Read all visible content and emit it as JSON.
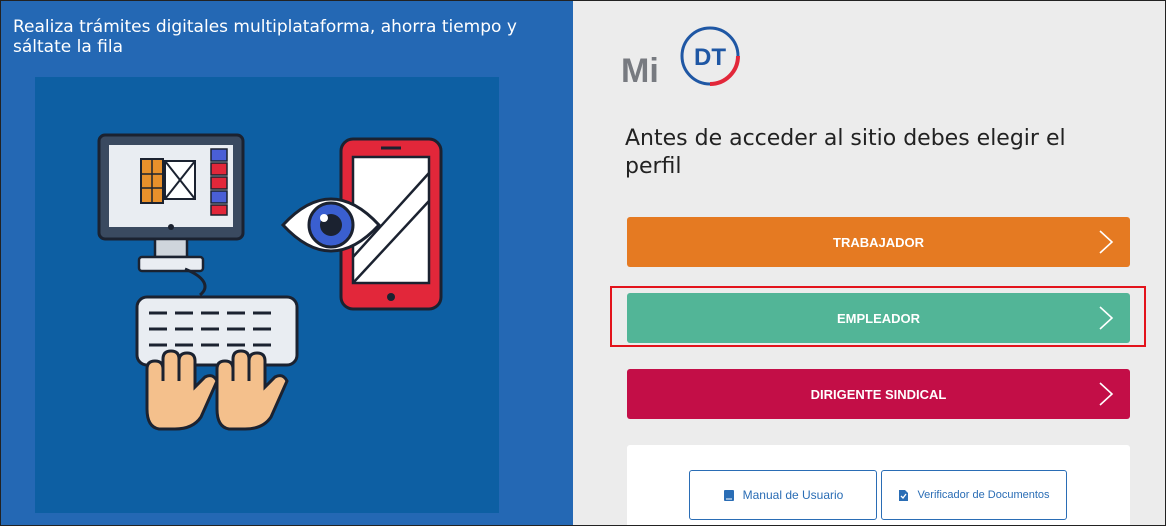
{
  "left": {
    "tagline": "Realiza trámites digitales multiplataforma, ahorra tiempo y sáltate la fila"
  },
  "logo": {
    "mi": "Mi",
    "dt": "DT"
  },
  "heading": "Antes de acceder al sitio debes elegir el perfil",
  "profiles": [
    {
      "label": "TRABAJADOR",
      "color": "#e57a22"
    },
    {
      "label": "EMPLEADOR",
      "color": "#52b597"
    },
    {
      "label": "DIRIGENTE SINDICAL",
      "color": "#c30e47"
    }
  ],
  "highlight_color": "#e3131b",
  "links": {
    "manual": "Manual de Usuario",
    "verificador": "Verificador de Documentos"
  },
  "icons": {
    "chevron": "chevron-right-icon",
    "manual": "book-icon",
    "verificador": "document-check-icon"
  }
}
